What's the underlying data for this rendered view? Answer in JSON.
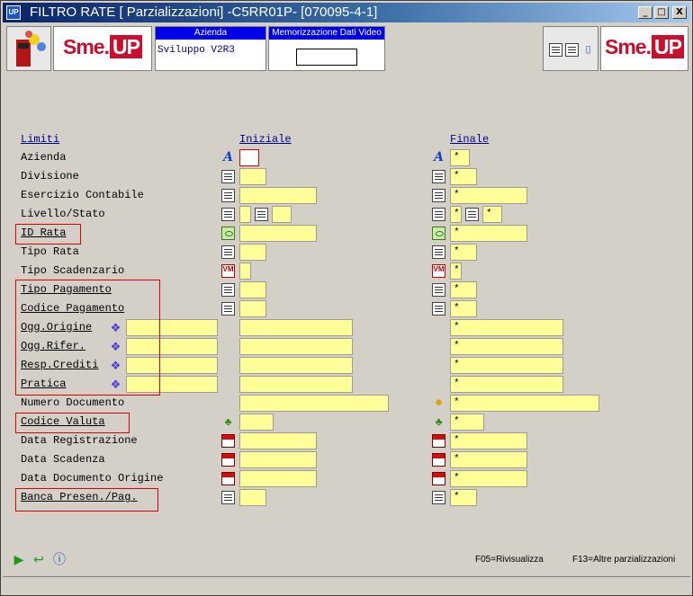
{
  "window": {
    "title": "FILTRO RATE [ Parzializzazioni] -C5RR01P- [070095-4-1]",
    "app_icon": "UP",
    "minimize_label": "_",
    "maximize_label": "□",
    "close_label": "X"
  },
  "toolbar": {
    "logo_text": "Sme.",
    "logo_up": "UP",
    "azienda_header": "Azienda",
    "azienda_value": "Sviluppo V2R3",
    "memo_header": "Memorizzazione Dati Video",
    "memo_value": ""
  },
  "columns": {
    "limits": "Limiti",
    "initial": "Iniziale",
    "final": "Finale"
  },
  "rows": [
    {
      "label": "Azienda",
      "initial": "",
      "final": "*"
    },
    {
      "label": "Divisione",
      "initial": "",
      "final": "*"
    },
    {
      "label": "Esercizio Contabile",
      "initial": "",
      "final": "*"
    },
    {
      "label": "Livello/Stato",
      "initial_a": "",
      "initial_b": "",
      "final_a": "*",
      "final_b": "*"
    },
    {
      "label": "ID Rata",
      "initial": "",
      "final": "*"
    },
    {
      "label": "Tipo Rata",
      "initial": "",
      "final": "*"
    },
    {
      "label": "Tipo Scadenzario",
      "initial": "",
      "final": "*"
    },
    {
      "label": "Tipo Pagamento",
      "initial": "",
      "final": "*"
    },
    {
      "label": "Codice Pagamento",
      "initial": "",
      "final": "*"
    },
    {
      "label": "Ogg.Origine",
      "type": "",
      "initial": "",
      "final": "*"
    },
    {
      "label": "Ogg.Rifer.",
      "type": "",
      "initial": "",
      "final": "*"
    },
    {
      "label": "Resp.Crediti",
      "type": "",
      "initial": "",
      "final": "*"
    },
    {
      "label": "Pratica",
      "type": "",
      "initial": "",
      "final": "*"
    },
    {
      "label": "Numero Documento",
      "initial": "",
      "final": "*"
    },
    {
      "label": "Codice Valuta",
      "initial": "",
      "final": "*"
    },
    {
      "label": "Data Registrazione",
      "initial": "",
      "final": "*"
    },
    {
      "label": "Data Scadenza",
      "initial": "",
      "final": "*"
    },
    {
      "label": "Data Documento Origine",
      "initial": "",
      "final": "*"
    },
    {
      "label": "Banca Presen./Pag.",
      "initial": "",
      "final": "*"
    }
  ],
  "footer": {
    "f05": "F05=Rivisualizza",
    "f13": "F13=Altre parzializzazioni"
  }
}
